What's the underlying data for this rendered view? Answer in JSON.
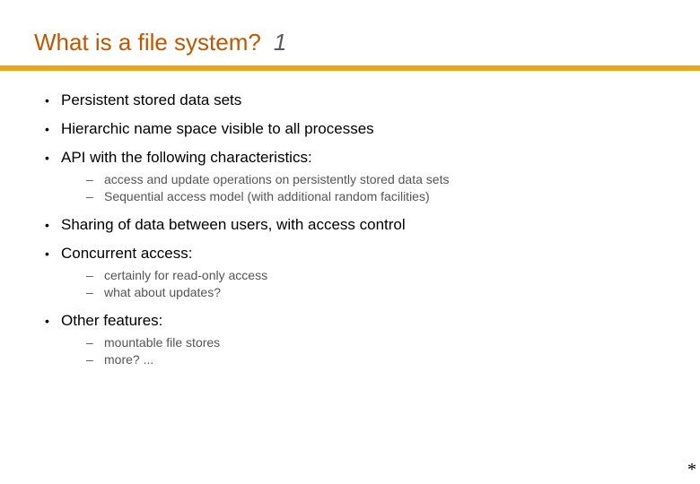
{
  "title": {
    "main": "What is a file system?",
    "num": "1"
  },
  "bullets": {
    "b1": "Persistent stored data sets",
    "b2": "Hierarchic name space visible to all processes",
    "b3": "API with the following characteristics:",
    "b3s1": "access and update operations on persistently stored data sets",
    "b3s2": "Sequential access model (with additional random facilities)",
    "b4": "Sharing of data between users, with access control",
    "b5": "Concurrent access:",
    "b5s1": "certainly for read-only access",
    "b5s2": "what about updates?",
    "b6": "Other features:",
    "b6s1": "mountable file stores",
    "b6s2": "more? ..."
  },
  "footer": {
    "asterisk": "*",
    "pagemark": ""
  }
}
